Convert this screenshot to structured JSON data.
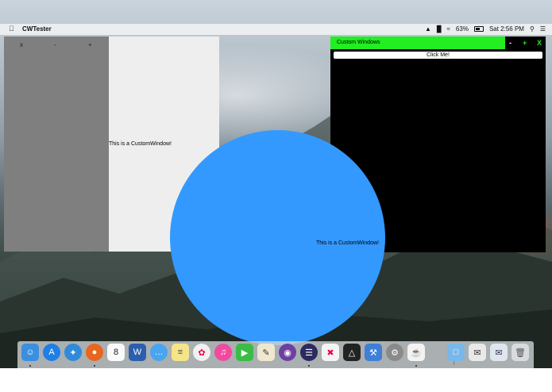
{
  "menubar": {
    "apple": "",
    "app_name": "CWTester",
    "battery": "63%",
    "clock": "Sat 2:56 PM"
  },
  "left_window": {
    "close": "x",
    "minimize": "-",
    "maximize": "+",
    "message": "This is a CustomWindow!"
  },
  "right_window": {
    "title": "Custom Windows",
    "minimize": "-",
    "maximize": "+",
    "close": "X",
    "button": "Click Me!"
  },
  "circle_window": {
    "message": "This is a CustomWindow!"
  },
  "colors": {
    "accent_green": "#22ee22",
    "circle_blue": "#3399ff",
    "sidebar_gray": "#7f7f7f"
  },
  "dock": {
    "calendar_day": "8",
    "word_letter": "W",
    "items": [
      "finder-icon",
      "app-store-icon",
      "safari-icon",
      "firefox-icon",
      "calendar-icon",
      "word-icon",
      "messages-icon",
      "notes-icon",
      "photos-icon",
      "itunes-icon",
      "facetime-icon",
      "textedit-icon",
      "github-icon",
      "eclipse-icon",
      "xcode-x-icon",
      "unity-icon",
      "xcode-icon",
      "system-preferences-icon",
      "java-icon",
      "folder-icon",
      "preview-icon",
      "mail-stack-icon",
      "trash-icon"
    ]
  }
}
